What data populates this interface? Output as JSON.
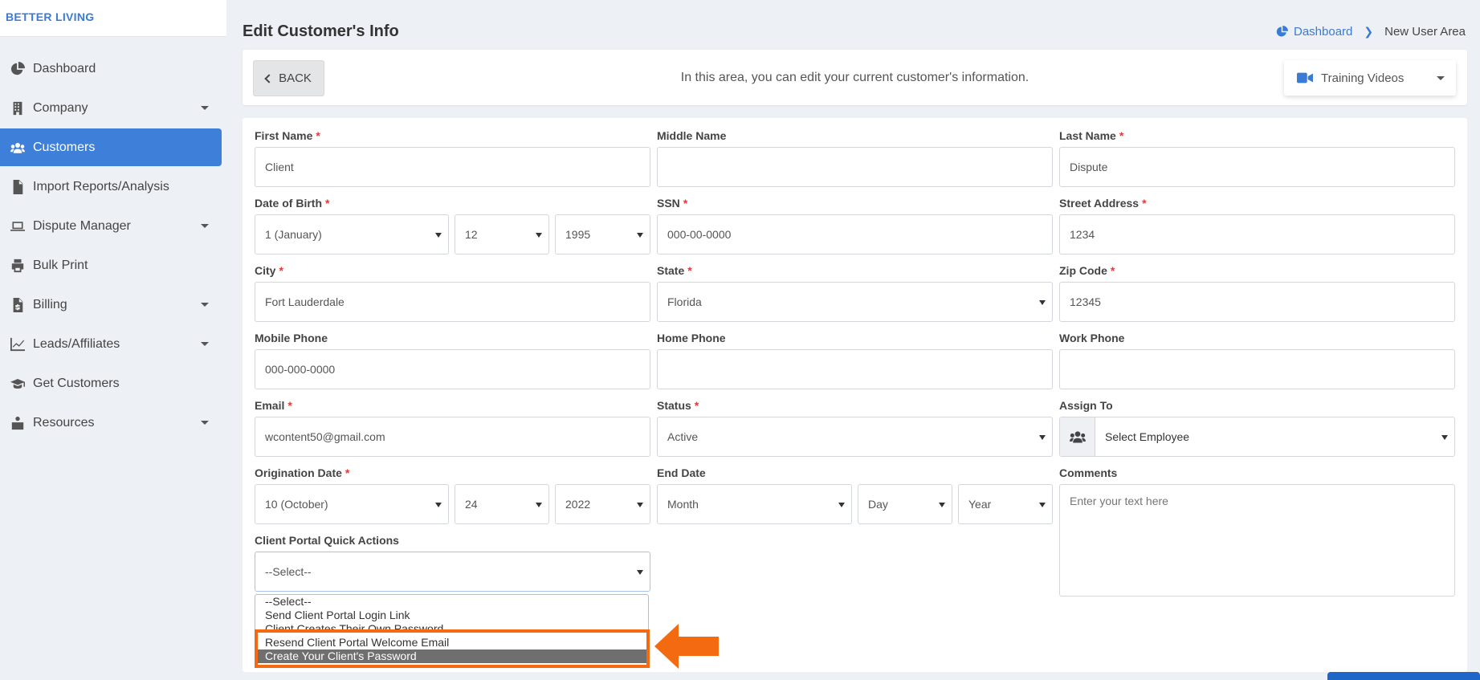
{
  "brand": "BETTER LIVING",
  "sidebar": {
    "items": [
      {
        "label": "Dashboard",
        "icon": "pie-chart-icon",
        "caret": false,
        "active": false
      },
      {
        "label": "Company",
        "icon": "building-icon",
        "caret": true,
        "active": false
      },
      {
        "label": "Customers",
        "icon": "users-icon",
        "caret": false,
        "active": true
      },
      {
        "label": "Import Reports/Analysis",
        "icon": "file-import-icon",
        "caret": false,
        "active": false
      },
      {
        "label": "Dispute Manager",
        "icon": "laptop-icon",
        "caret": true,
        "active": false
      },
      {
        "label": "Bulk Print",
        "icon": "print-icon",
        "caret": false,
        "active": false
      },
      {
        "label": "Billing",
        "icon": "invoice-icon",
        "caret": true,
        "active": false
      },
      {
        "label": "Leads/Affiliates",
        "icon": "line-chart-icon",
        "caret": true,
        "active": false
      },
      {
        "label": "Get Customers",
        "icon": "graduation-cap-icon",
        "caret": false,
        "active": false
      },
      {
        "label": "Resources",
        "icon": "briefcase-icon",
        "caret": true,
        "active": false
      }
    ]
  },
  "header": {
    "title": "Edit Customer's Info",
    "breadcrumb": {
      "home": "Dashboard",
      "current": "New User Area"
    }
  },
  "infobar": {
    "back_label": "BACK",
    "text": "In this area, you can edit your current customer's information.",
    "training_label": "Training Videos"
  },
  "form": {
    "first_name": {
      "label": "First Name",
      "value": "Client"
    },
    "middle_name": {
      "label": "Middle Name",
      "value": ""
    },
    "last_name": {
      "label": "Last Name",
      "value": "Dispute"
    },
    "dob": {
      "label": "Date of Birth",
      "month": "1 (January)",
      "day": "12",
      "year": "1995"
    },
    "ssn": {
      "label": "SSN",
      "value": "000-00-0000"
    },
    "street": {
      "label": "Street Address",
      "value": "1234"
    },
    "city": {
      "label": "City",
      "value": "Fort Lauderdale"
    },
    "state": {
      "label": "State",
      "value": "Florida"
    },
    "zip": {
      "label": "Zip Code",
      "value": "12345"
    },
    "mobile": {
      "label": "Mobile Phone",
      "value": "000-000-0000"
    },
    "home_phone": {
      "label": "Home Phone",
      "value": ""
    },
    "work_phone": {
      "label": "Work Phone",
      "value": ""
    },
    "email": {
      "label": "Email",
      "value": "wcontent50@gmail.com"
    },
    "status": {
      "label": "Status",
      "value": "Active"
    },
    "assign": {
      "label": "Assign To",
      "value": "Select Employee"
    },
    "origination": {
      "label": "Origination Date",
      "month": "10 (October)",
      "day": "24",
      "year": "2022"
    },
    "end_date": {
      "label": "End Date",
      "month": "Month",
      "day": "Day",
      "year": "Year"
    },
    "comments": {
      "label": "Comments",
      "placeholder": "Enter your text here"
    },
    "quick_actions": {
      "label": "Client Portal Quick Actions",
      "value": "--Select--",
      "options": [
        "--Select--",
        "Send Client Portal Login Link",
        "Client Creates Their Own Password",
        "Resend Client Portal Welcome Email",
        "Create Your Client's Password"
      ],
      "selected_index": 4
    }
  },
  "colors": {
    "accent": "#3d7fd9",
    "required": "#e03b3b",
    "highlight": "#f36a10"
  }
}
